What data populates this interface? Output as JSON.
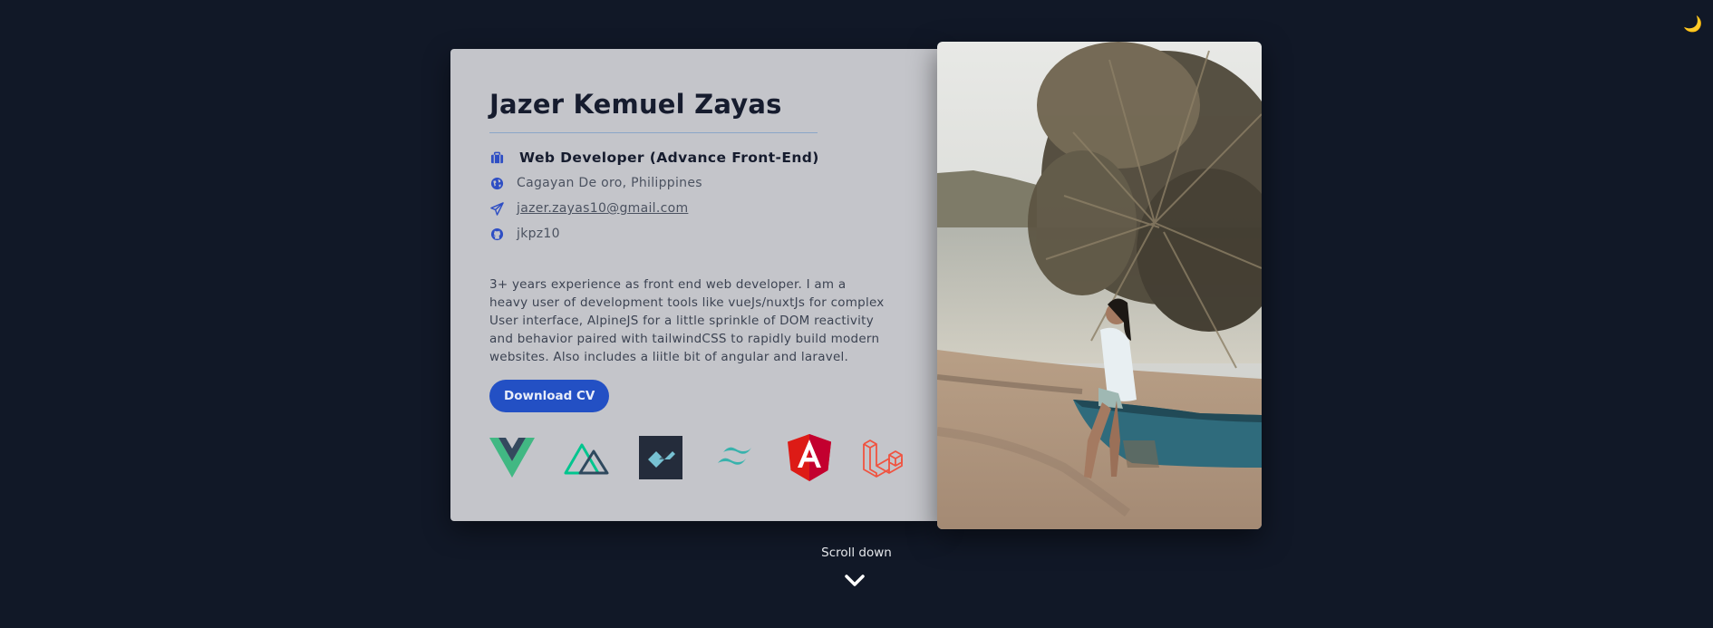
{
  "theme_toggle": {
    "icon": "moon-icon",
    "glyph": "🌙"
  },
  "profile": {
    "name": "Jazer Kemuel Zayas",
    "title": "Web Developer (Advance Front-End)",
    "location": "Cagayan De oro, Philippines",
    "email": "jazer.zayas10@gmail.com",
    "github": "jkpz10",
    "bio": "3+ years experience as front end web developer. I am a heavy user of development tools like vueJs/nuxtJs for complex User interface, AlpineJS for a little sprinkle of DOM reactivity and behavior paired with tailwindCSS to rapidly build modern websites. Also includes a liitle bit of angular and laravel."
  },
  "actions": {
    "download_label": "Download CV"
  },
  "tech_stack": [
    {
      "icon": "vue-icon",
      "color": "#41b883"
    },
    {
      "icon": "nuxt-icon",
      "color": "#00c58e"
    },
    {
      "icon": "alpine-icon",
      "color": "#77c1d2"
    },
    {
      "icon": "tailwind-icon",
      "color": "#38bdf8"
    },
    {
      "icon": "angular-icon",
      "color": "#dd1b16"
    },
    {
      "icon": "laravel-icon",
      "color": "#ff2d20"
    }
  ],
  "footer": {
    "scroll_label": "Scroll down",
    "icon": "chevron-down-icon"
  },
  "colors": {
    "background": "#111827",
    "card": "#c4c5ca",
    "accent": "#2350c4"
  }
}
